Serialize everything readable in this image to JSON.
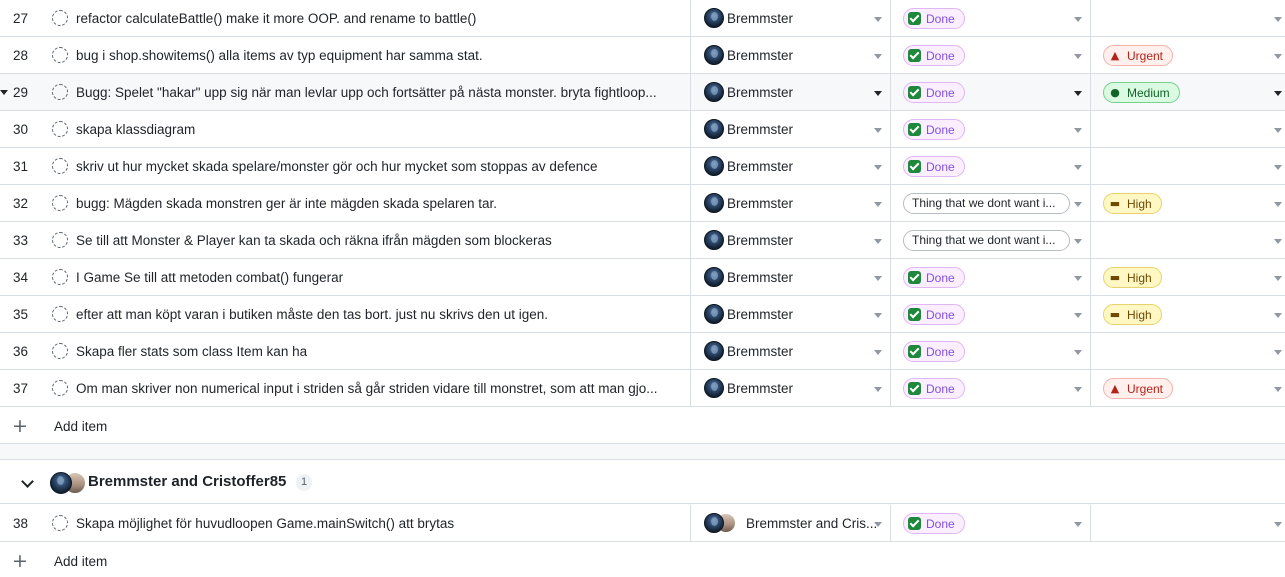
{
  "rows": [
    {
      "num": "27",
      "title": "refactor calculateBattle() make it more OOP. and rename to battle()",
      "assignee": "Bremmster",
      "status": "Done",
      "priority": ""
    },
    {
      "num": "28",
      "title": "bug i shop.showitems() alla items av typ equipment har samma stat.",
      "assignee": "Bremmster",
      "status": "Done",
      "priority": "Urgent"
    },
    {
      "num": "29",
      "title": "Bugg: Spelet \"hakar\" upp sig när man levlar upp och fortsätter på nästa monster. bryta fightloop...",
      "assignee": "Bremmster",
      "status": "Done",
      "priority": "Medium"
    },
    {
      "num": "30",
      "title": "skapa klassdiagram",
      "assignee": "Bremmster",
      "status": "Done",
      "priority": ""
    },
    {
      "num": "31",
      "title": "skriv ut hur mycket skada spelare/monster gör och hur mycket som stoppas av defence",
      "assignee": "Bremmster",
      "status": "Done",
      "priority": ""
    },
    {
      "num": "32",
      "title": "bugg: Mägden skada monstren ger är inte mägden skada spelaren tar.",
      "assignee": "Bremmster",
      "status": "Thing that we dont want i...",
      "priority": "High"
    },
    {
      "num": "33",
      "title": "Se till att Monster & Player kan ta skada och räkna ifrån mägden som blockeras",
      "assignee": "Bremmster",
      "status": "Thing that we dont want i...",
      "priority": ""
    },
    {
      "num": "34",
      "title": "I Game Se till att metoden combat() fungerar",
      "assignee": "Bremmster",
      "status": "Done",
      "priority": "High"
    },
    {
      "num": "35",
      "title": "efter att man köpt varan i butiken måste den tas bort. just nu skrivs den ut igen.",
      "assignee": "Bremmster",
      "status": "Done",
      "priority": "High"
    },
    {
      "num": "36",
      "title": "Skapa fler stats som class Item kan ha",
      "assignee": "Bremmster",
      "status": "Done",
      "priority": ""
    },
    {
      "num": "37",
      "title": "Om man skriver non numerical input i striden så går striden vidare till monstret, som att man gjo...",
      "assignee": "Bremmster",
      "status": "Done",
      "priority": "Urgent"
    }
  ],
  "add_item_label": "Add item",
  "group": {
    "title": "Bremmster and Cristoffer85",
    "count": "1",
    "rows": [
      {
        "num": "38",
        "title": "Skapa möjlighet för huvudloopen Game.mainSwitch() att brytas",
        "assignee": "Bremmster and Cris...",
        "status": "Done",
        "priority": ""
      }
    ],
    "add_item_label": "Add item"
  },
  "colors": {
    "done": "#8250df",
    "urgent": "#b42318",
    "high": "#6e4a00",
    "medium": "#116329"
  },
  "icons": {
    "urgent": "volcano-icon",
    "high": "car-icon",
    "medium": "snail-icon"
  }
}
